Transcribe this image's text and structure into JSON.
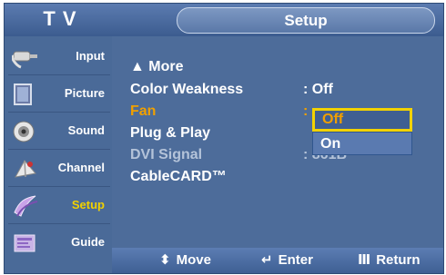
{
  "header": {
    "tv_label": "T V",
    "title": "Setup"
  },
  "sidebar": {
    "items": [
      {
        "label": "Input",
        "icon": "input-cable-icon"
      },
      {
        "label": "Picture",
        "icon": "picture-icon"
      },
      {
        "label": "Sound",
        "icon": "speaker-icon"
      },
      {
        "label": "Channel",
        "icon": "satellite-icon"
      },
      {
        "label": "Setup",
        "icon": "setup-icon",
        "active": true
      },
      {
        "label": "Guide",
        "icon": "guide-icon"
      }
    ]
  },
  "menu": {
    "more_label": "▲ More",
    "rows": [
      {
        "label": "Color Weakness",
        "value": ": Off"
      },
      {
        "label": "Fan",
        "value": ":"
      },
      {
        "label": "Plug & Play",
        "value": ""
      },
      {
        "label": "DVI Signal",
        "value": ": 861B"
      },
      {
        "label": "CableCARD™",
        "value": ""
      }
    ],
    "dropdown": {
      "options": [
        "Off",
        "On"
      ],
      "current": "Off"
    }
  },
  "footer": {
    "move": "Move",
    "enter": "Enter",
    "return": "Return"
  },
  "colors": {
    "background": "#4d6c9a",
    "highlight": "#f0a000",
    "selection_border": "#f2d200"
  }
}
